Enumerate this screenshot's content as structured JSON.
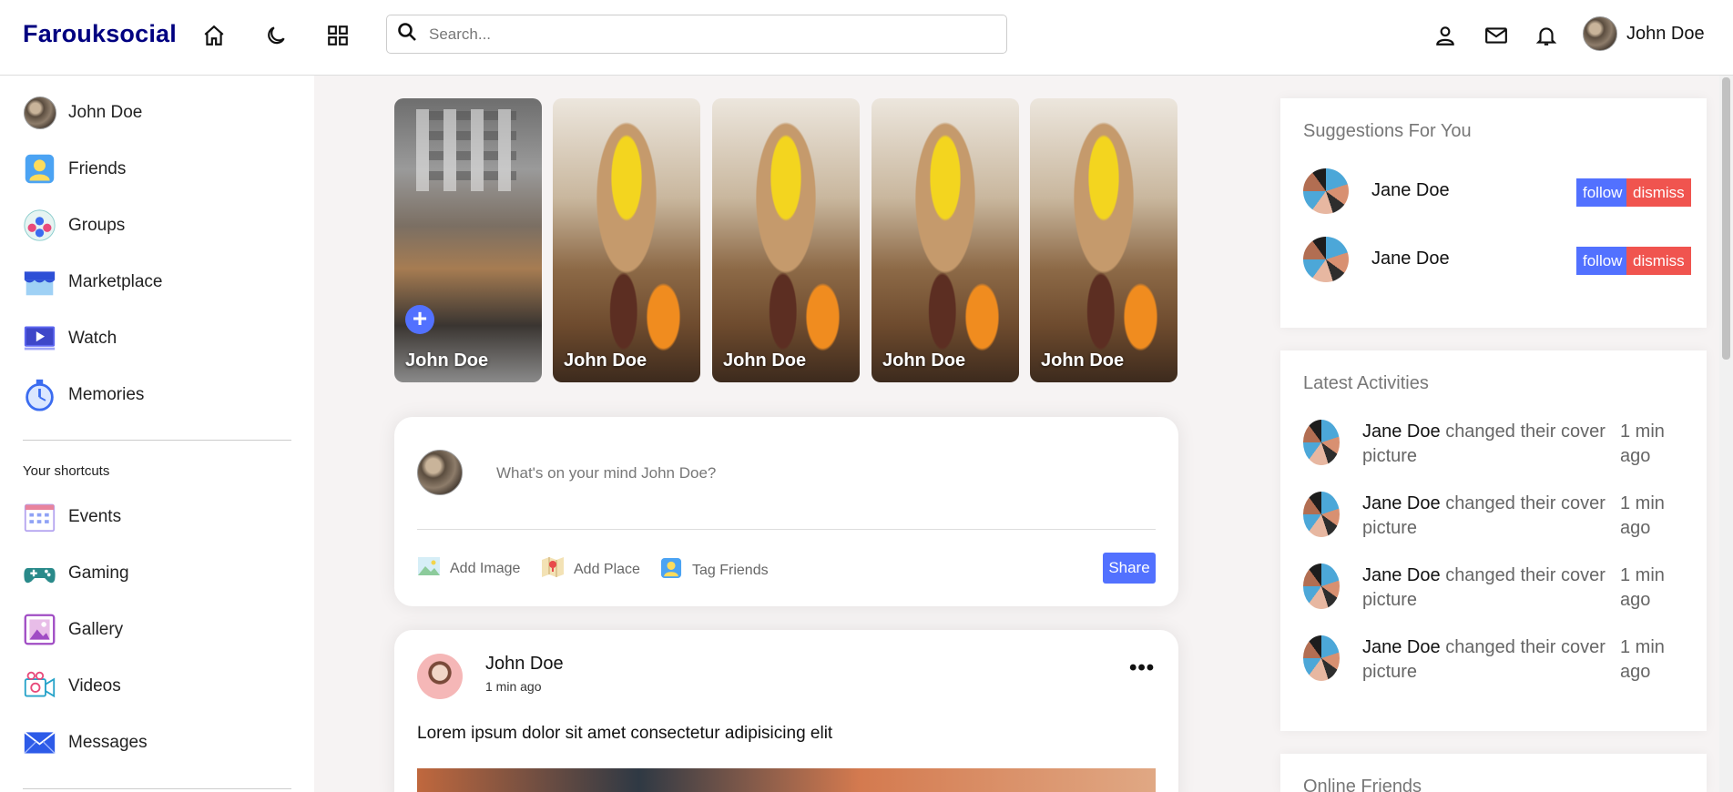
{
  "navbar": {
    "logo": "Farouksocial",
    "search_placeholder": "Search...",
    "user_name": "John Doe"
  },
  "sidebar": {
    "items": [
      {
        "label": "John Doe",
        "icon": "user-avatar"
      },
      {
        "label": "Friends",
        "icon": "friends-icon"
      },
      {
        "label": "Groups",
        "icon": "groups-icon"
      },
      {
        "label": "Marketplace",
        "icon": "marketplace-icon"
      },
      {
        "label": "Watch",
        "icon": "watch-icon"
      },
      {
        "label": "Memories",
        "icon": "memories-icon"
      }
    ],
    "shortcuts_title": "Your shortcuts",
    "shortcuts": [
      {
        "label": "Events",
        "icon": "events-icon"
      },
      {
        "label": "Gaming",
        "icon": "gaming-icon"
      },
      {
        "label": "Gallery",
        "icon": "gallery-icon"
      },
      {
        "label": "Videos",
        "icon": "videos-icon"
      },
      {
        "label": "Messages",
        "icon": "messages-icon"
      }
    ]
  },
  "stories": [
    {
      "name": "John Doe",
      "own": true
    },
    {
      "name": "John Doe"
    },
    {
      "name": "John Doe"
    },
    {
      "name": "John Doe"
    },
    {
      "name": "John Doe"
    }
  ],
  "share": {
    "prompt": "What's on your mind John Doe?",
    "add_image": "Add Image",
    "add_place": "Add Place",
    "tag_friends": "Tag Friends",
    "share_label": "Share"
  },
  "post": {
    "author": "John Doe",
    "time": "1 min ago",
    "text": "Lorem ipsum dolor sit amet consectetur adipisicing elit"
  },
  "suggestions": {
    "title": "Suggestions For You",
    "items": [
      {
        "name": "Jane Doe",
        "follow": "follow",
        "dismiss": "dismiss"
      },
      {
        "name": "Jane Doe",
        "follow": "follow",
        "dismiss": "dismiss"
      }
    ]
  },
  "activities": {
    "title": "Latest Activities",
    "items": [
      {
        "name": "Jane Doe",
        "action": "changed their cover picture",
        "time": "1 min ago"
      },
      {
        "name": "Jane Doe",
        "action": "changed their cover picture",
        "time": "1 min ago"
      },
      {
        "name": "Jane Doe",
        "action": "changed their cover picture",
        "time": "1 min ago"
      },
      {
        "name": "Jane Doe",
        "action": "changed their cover picture",
        "time": "1 min ago"
      }
    ]
  },
  "online": {
    "title": "Online Friends"
  },
  "colors": {
    "brand": "#000080",
    "accent": "#5271ff",
    "danger": "#f0544f"
  }
}
